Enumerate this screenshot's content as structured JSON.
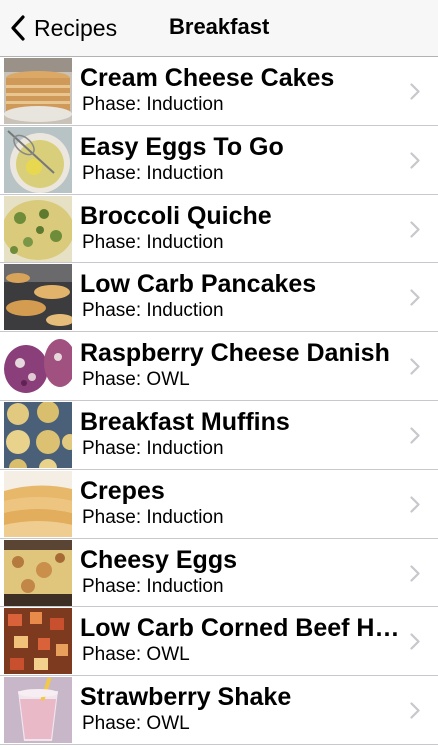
{
  "nav": {
    "back_label": "Recipes",
    "title": "Breakfast"
  },
  "recipes": [
    {
      "title": "Cream Cheese Cakes",
      "phase": "Phase: Induction",
      "image": "pancake-stack-photo"
    },
    {
      "title": "Easy Eggs To Go",
      "phase": "Phase: Induction",
      "image": "whisked-eggs-bowl-photo"
    },
    {
      "title": "Broccoli Quiche",
      "phase": "Phase: Induction",
      "image": "broccoli-quiche-photo"
    },
    {
      "title": "Low Carb Pancakes",
      "phase": "Phase: Induction",
      "image": "griddle-pancakes-photo"
    },
    {
      "title": "Raspberry Cheese Danish",
      "phase": "Phase: OWL",
      "image": "raspberry-danish-photo"
    },
    {
      "title": "Breakfast Muffins",
      "phase": "Phase: Induction",
      "image": "muffin-tin-photo"
    },
    {
      "title": "Crepes",
      "phase": "Phase: Induction",
      "image": "crepes-photo"
    },
    {
      "title": "Cheesy Eggs",
      "phase": "Phase: Induction",
      "image": "cheesy-eggs-photo"
    },
    {
      "title": "Low Carb Corned Beef Hash",
      "phase": "Phase: OWL",
      "image": "corned-beef-hash-photo"
    },
    {
      "title": "Strawberry Shake",
      "phase": "Phase: OWL",
      "image": "strawberry-shake-photo"
    }
  ],
  "icons": {
    "back": "chevron-left-icon",
    "disclosure": "chevron-right-icon"
  }
}
